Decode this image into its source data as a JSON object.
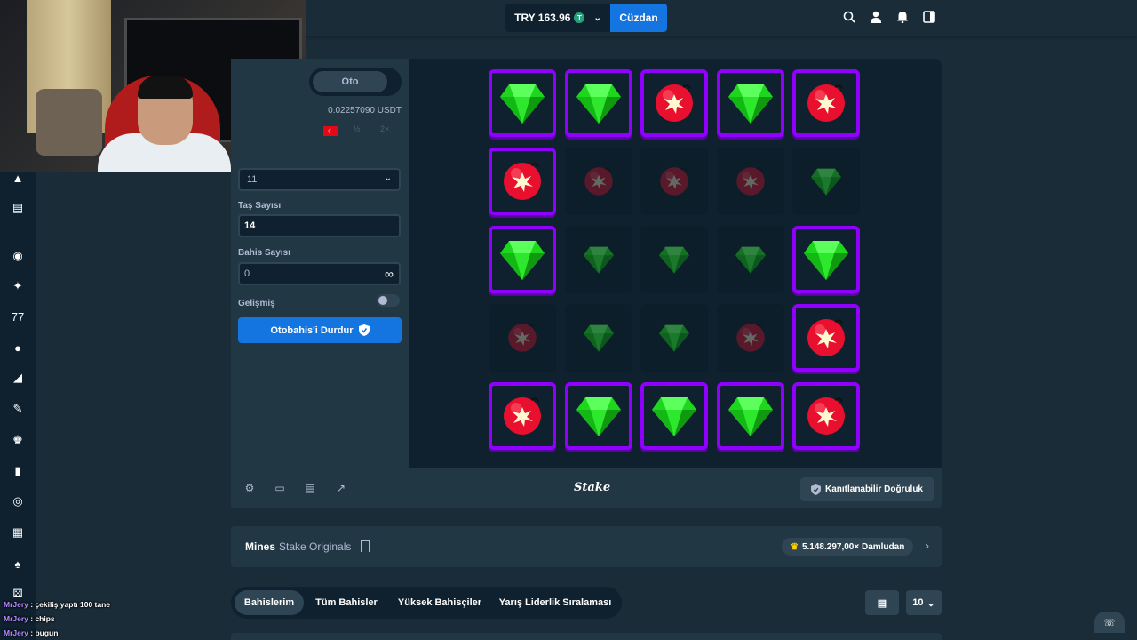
{
  "header": {
    "balance": "TRY 163.96",
    "coin_symbol": "T",
    "wallet_button": "Cüzdan",
    "icons": [
      "search-icon",
      "user-icon",
      "bell-icon",
      "sidebar-toggle-icon"
    ]
  },
  "controls": {
    "tab_auto": "Oto",
    "usdt_value": "0.02257090 USDT",
    "half_label": "½",
    "double_label": "2×",
    "mines_select_value": "11",
    "gems_label": "Taş Sayısı",
    "gems_value": "14",
    "bet_count_label": "Bahis Sayısı",
    "bet_count_value": "0",
    "advanced_label": "Gelişmiş",
    "stop_autobet_button": "Otobahis'i Durdur"
  },
  "board": {
    "tiles": [
      "gem-revealed",
      "gem-revealed",
      "mine-revealed",
      "gem-revealed",
      "mine-revealed",
      "mine-revealed",
      "mine-hidden",
      "mine-hidden",
      "mine-hidden",
      "gem-hidden",
      "gem-revealed",
      "gem-hidden",
      "gem-hidden",
      "gem-hidden",
      "gem-revealed",
      "mine-hidden",
      "gem-hidden",
      "gem-hidden",
      "mine-hidden",
      "mine-revealed",
      "mine-revealed",
      "gem-revealed",
      "gem-revealed",
      "gem-revealed",
      "mine-revealed"
    ],
    "colors": {
      "selected_border": "#9000ff",
      "gem": "#2ee82e",
      "mine": "#e8102e"
    }
  },
  "footer": {
    "brand": "Stake",
    "fairness_button": "Kanıtlanabilir Doğruluk"
  },
  "game_info": {
    "title": "Mines",
    "subtitle": "Stake Originals",
    "record_badge": "5.148.297,00× Damludan"
  },
  "bets_tabs": [
    "Bahislerim",
    "Tüm Bahisler",
    "Yüksek Bahisçiler",
    "Yarış Liderlik Sıralaması"
  ],
  "bets_count": "10",
  "chat": [
    {
      "user": "MrJery",
      "message": "çekiliş yaptı 100 tane"
    },
    {
      "user": "MrJery",
      "message": "chips"
    },
    {
      "user": "MrJery",
      "message": "bugun"
    }
  ]
}
